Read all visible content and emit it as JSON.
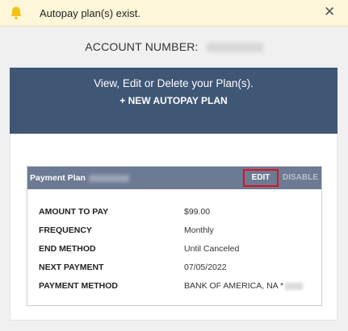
{
  "alert": {
    "icon": "bell-icon",
    "message": "Autopay plan(s) exist.",
    "close_glyph": "✕"
  },
  "account": {
    "label": "ACCOUNT NUMBER:"
  },
  "plans_panel": {
    "subtitle": "View, Edit or Delete your Plan(s).",
    "new_plan_label": "+ NEW AUTOPAY PLAN"
  },
  "plan": {
    "title": "Payment Plan",
    "edit_label": "EDIT",
    "disable_label": "DISABLE",
    "details": [
      {
        "key": "AMOUNT TO PAY",
        "value": "$99.00"
      },
      {
        "key": "FREQUENCY",
        "value": "Monthly"
      },
      {
        "key": "END METHOD",
        "value": "Until Canceled"
      },
      {
        "key": "NEXT PAYMENT",
        "value": "07/05/2022"
      },
      {
        "key": "PAYMENT METHOD",
        "value": "BANK OF AMERICA, NA *"
      }
    ]
  },
  "colors": {
    "alert_bg": "#fdf6d9",
    "bell": "#f2c315",
    "panel_bg": "#3f5675",
    "plan_header_bg": "#6c7a93",
    "highlight_border": "#e01020"
  }
}
